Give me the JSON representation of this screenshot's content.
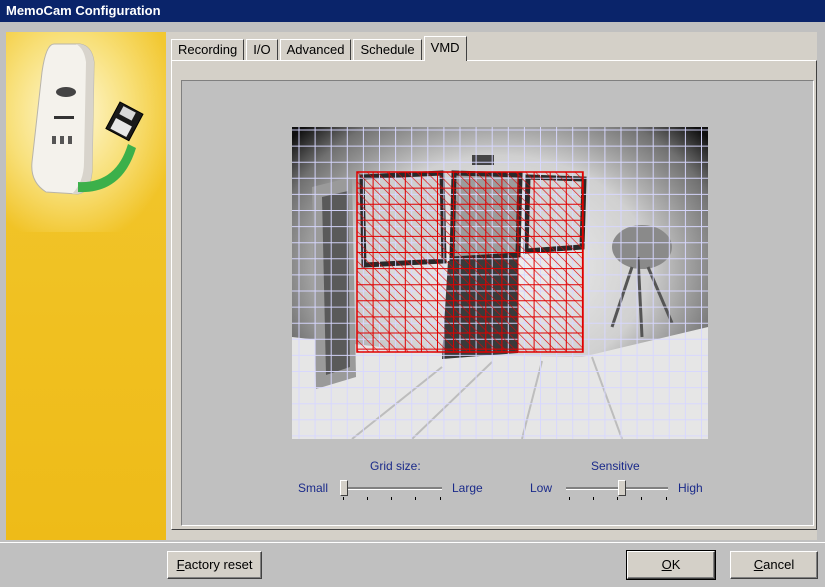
{
  "window": {
    "title": "MemoCam Configuration"
  },
  "tabs": [
    {
      "label": "Recording",
      "active": false
    },
    {
      "label": "I/O",
      "active": false
    },
    {
      "label": "Advanced",
      "active": false
    },
    {
      "label": "Schedule",
      "active": false
    },
    {
      "label": "VMD",
      "active": true
    }
  ],
  "grid_size": {
    "caption": "Grid size:",
    "min_label": "Small",
    "max_label": "Large",
    "level": 0.0
  },
  "sensitivity": {
    "caption": "Sensitive",
    "min_label": "Low",
    "max_label": "High",
    "level": 0.55
  },
  "buttons": {
    "factory_reset_accel": "F",
    "factory_reset_rest": "actory reset",
    "ok_accel": "O",
    "ok_rest": "K",
    "cancel_accel": "C",
    "cancel_rest": "ancel"
  },
  "colors": {
    "title_bar": "#0a246a",
    "sidebar": "#f0c020",
    "selection": "#e00000",
    "grid": "#d8d8ff"
  }
}
